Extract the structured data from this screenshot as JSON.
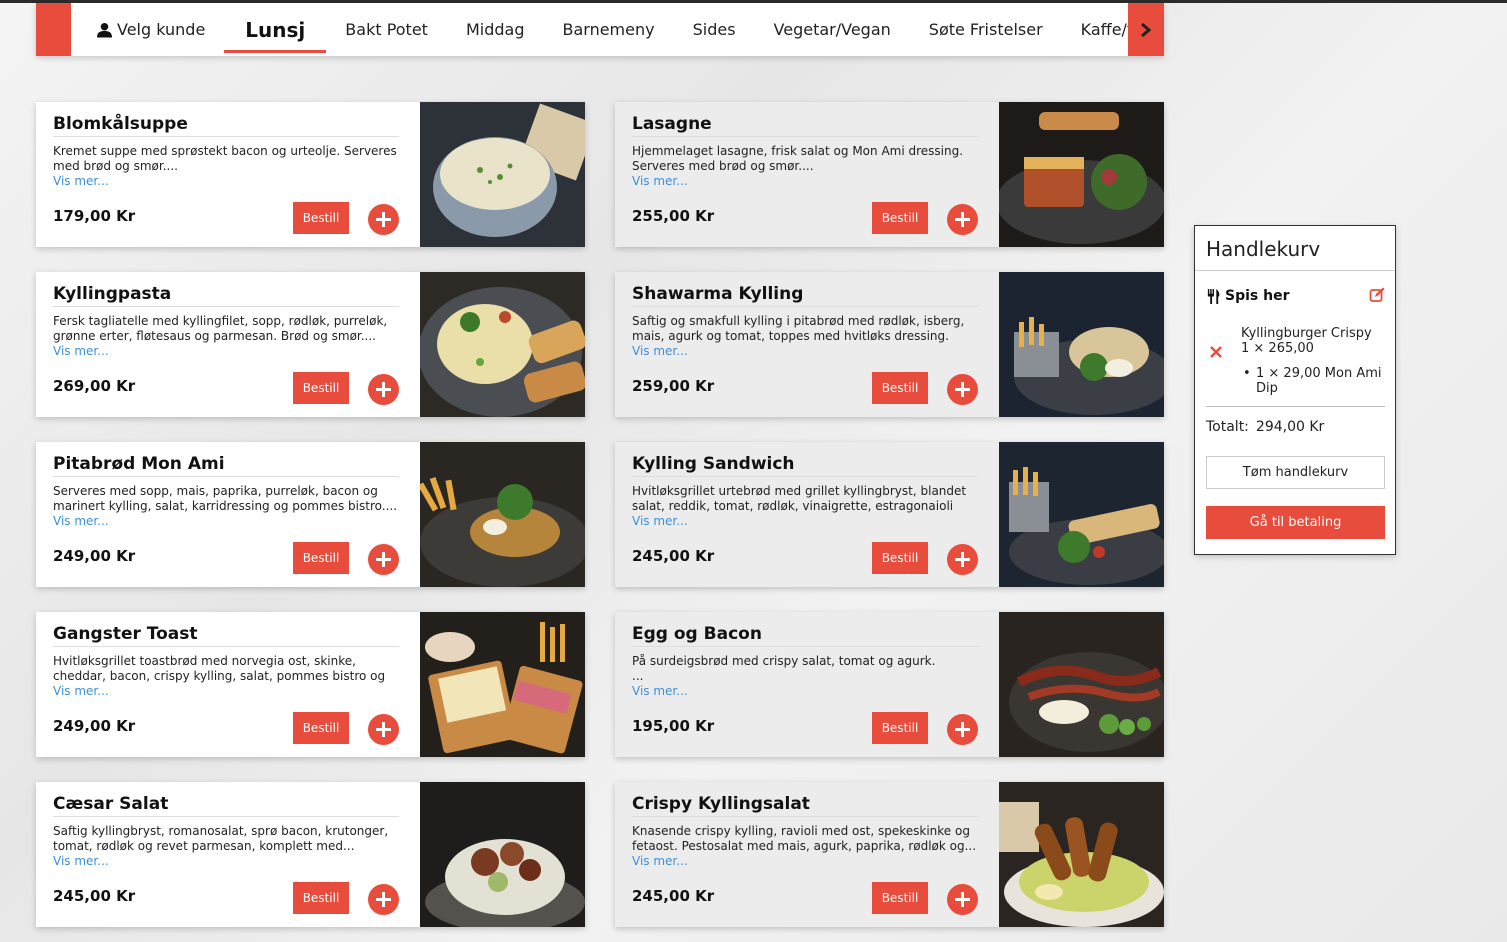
{
  "nav": {
    "customer_label": "Velg kunde",
    "tabs": [
      "Lunsj",
      "Bakt Potet",
      "Middag",
      "Barnemeny",
      "Sides",
      "Vegetar/Vegan",
      "Søte Fristelser",
      "Kaffe/te"
    ],
    "active_tab": "Lunsj"
  },
  "menu": {
    "more_label": "Vis mer...",
    "order_label": "Bestill",
    "items": [
      {
        "name": "Blomkålsuppe",
        "desc": "Kremet suppe med sprøstekt bacon og urteolje. Serveres med brød og smør....",
        "price": "179,00 Kr"
      },
      {
        "name": "Lasagne",
        "desc": "Hjemmelaget lasagne, frisk salat og Mon Ami dressing. Serveres med brød og smør....",
        "price": "255,00 Kr"
      },
      {
        "name": "Kyllingpasta",
        "desc": "Fersk tagliatelle med kyllingfilet, sopp, rødløk, purreløk, grønne erter, fløtesaus og parmesan. Brød og smør....",
        "price": "269,00 Kr"
      },
      {
        "name": "Shawarma Kylling",
        "desc": "Saftig og smakfull kylling i pitabrød med rødløk, isberg, mais, agurk og tomat, toppes med hvitløks dressing. Serveres m...",
        "price": "259,00 Kr"
      },
      {
        "name": "Pitabrød Mon Ami",
        "desc": "Serveres med sopp, mais, paprika, purreløk, bacon og marinert kylling, salat, karridressing og pommes bistro....",
        "price": "249,00 Kr"
      },
      {
        "name": "Kylling Sandwich",
        "desc": "Hvitløksgrillet urtebrød med grillet kyllingbryst, blandet salat, reddik, tomat, rødløk, vinaigrette, estragonaioli og...",
        "price": "245,00 Kr"
      },
      {
        "name": "Gangster Toast",
        "desc": "Hvitløksgrillet toastbrød med norvegia ost, skinke, cheddar, bacon, crispy kylling, salat, pommes bistro og dip....",
        "price": "249,00 Kr"
      },
      {
        "name": "Egg og Bacon",
        "desc": "På surdeigsbrød med crispy salat, tomat og agurk.\n...",
        "price": "195,00 Kr"
      },
      {
        "name": "Cæsar Salat",
        "desc": "Saftig kyllingbryst, romanosalat, sprø bacon, krutonger, tomat, rødløk og revet parmesan, komplett med...",
        "price": "245,00 Kr"
      },
      {
        "name": "Crispy Kyllingsalat",
        "desc": "Knasende crispy kylling, ravioli med ost, spekeskinke og fetaost. Pestosalat med mais, agurk, paprika, rødløk og...",
        "price": "245,00 Kr"
      }
    ]
  },
  "cart": {
    "title": "Handlekurv",
    "mode": "Spis her",
    "item_name": "Kyllingburger Crispy",
    "item_qty": "1 × 265,00",
    "addon": "1 × 29,00 Mon Ami Dip",
    "total_label": "Totalt:",
    "total_value": "294,00 Kr",
    "clear_label": "Tøm handlekurv",
    "pay_label": "Gå til betaling"
  },
  "colors": {
    "accent": "#e74c3c",
    "link": "#3c8fd8"
  },
  "icons": {
    "customer": "user-icon",
    "next": "chevron-right-icon",
    "add": "plus-icon",
    "mode": "cutlery-icon",
    "edit": "edit-icon",
    "remove": "close-icon"
  }
}
